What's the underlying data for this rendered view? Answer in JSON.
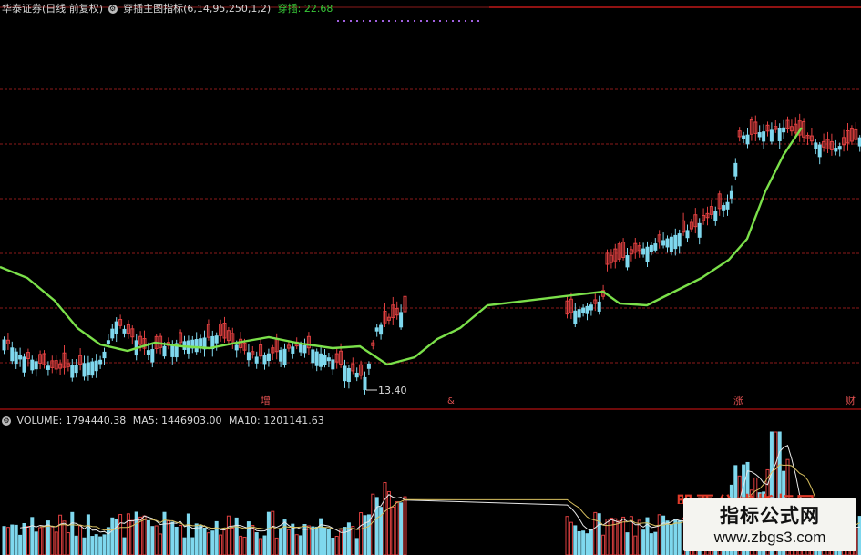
{
  "main_header": {
    "symbol": "华泰证券(日线 前复权)",
    "indicator_settings": "穿插主图指标(6,14,95,250,1,2)",
    "indicator_label": "穿插",
    "indicator_value": "22.68"
  },
  "volume_header": {
    "volume_label": "VOLUME:",
    "volume_value": "1794440.38",
    "ma5_label": "MA5:",
    "ma5_value": "1446903.00",
    "ma10_label": "MA10:",
    "ma10_value": "1201141.63"
  },
  "annotations": {
    "low_price": "13.40",
    "marker_1": "增",
    "marker_2": "&",
    "marker_3": "涨",
    "marker_4": "财"
  },
  "watermark": {
    "top_text": "股票公式指标网",
    "title": "指标公式网",
    "url": "www.zbgs3.com"
  },
  "colors": {
    "background": "#000000",
    "grid": "#8b1a1a",
    "up_candle": "#e04040",
    "down_candle": "#7fd8ee",
    "indicator_line": "#7be04a",
    "ma_line": "#e8e8e8",
    "separator": "#b01010"
  },
  "chart_data": {
    "type": "candlestick",
    "low_label": 13.4,
    "indicator": {
      "name": "穿插",
      "value": 22.68
    },
    "volume": {
      "volume": 1794440.38,
      "ma5": 1446903.0,
      "ma10": 1201141.63
    }
  }
}
